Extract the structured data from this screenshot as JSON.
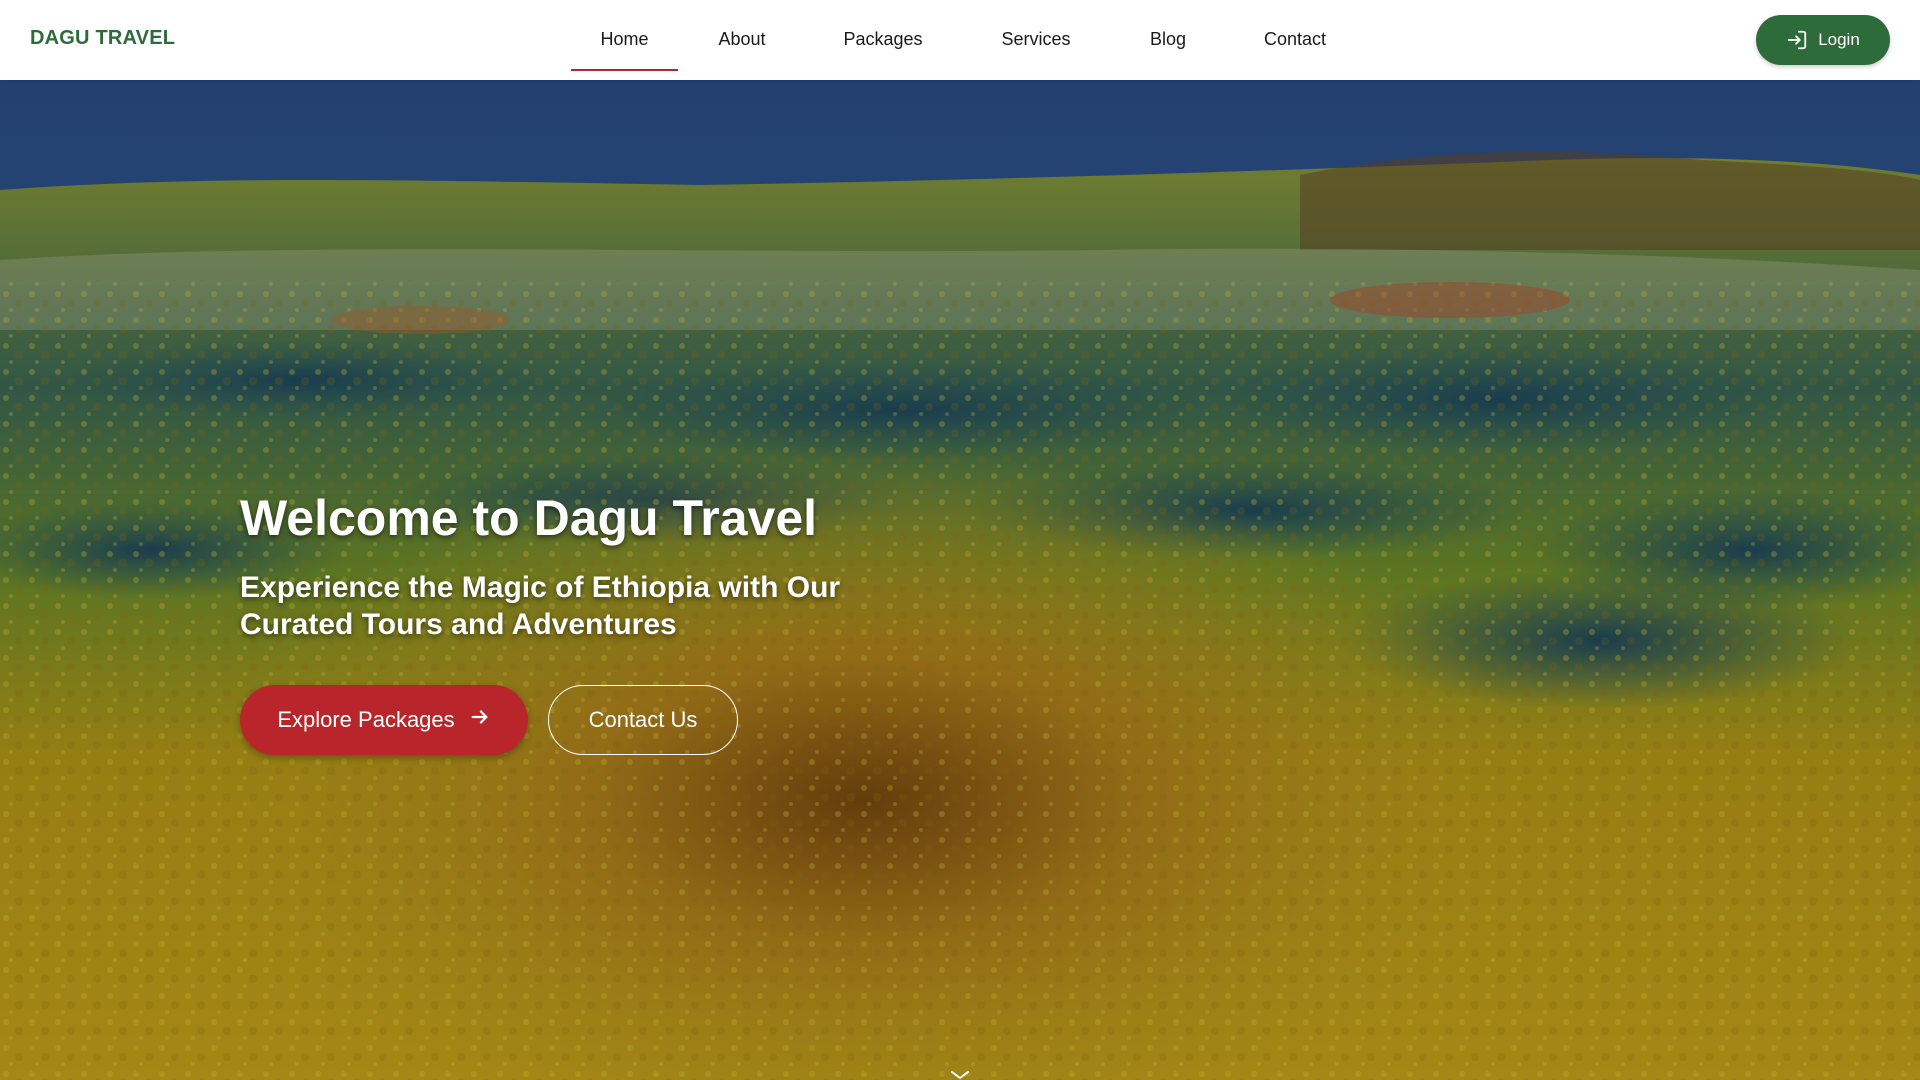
{
  "brand": {
    "name": "DAGU TRAVEL",
    "color": "#2e6b3a"
  },
  "nav": {
    "items": [
      {
        "label": "Home",
        "active": true
      },
      {
        "label": "About",
        "active": false
      },
      {
        "label": "Packages",
        "active": false
      },
      {
        "label": "Services",
        "active": false
      },
      {
        "label": "Blog",
        "active": false
      },
      {
        "label": "Contact",
        "active": false
      }
    ],
    "active_indicator_color": "#b3262e"
  },
  "login": {
    "label": "Login",
    "icon": "login-icon",
    "color": "#2e6b3a"
  },
  "hero": {
    "title": "Welcome to Dagu Travel",
    "subtitle": "Experience the Magic of Ethiopia with Our Curated Tours and Adventures",
    "primary_button": {
      "label": "Explore Packages",
      "icon": "arrow-right-icon",
      "color": "#b8262b"
    },
    "secondary_button": {
      "label": "Contact Us"
    },
    "background": "landscape-photo"
  }
}
